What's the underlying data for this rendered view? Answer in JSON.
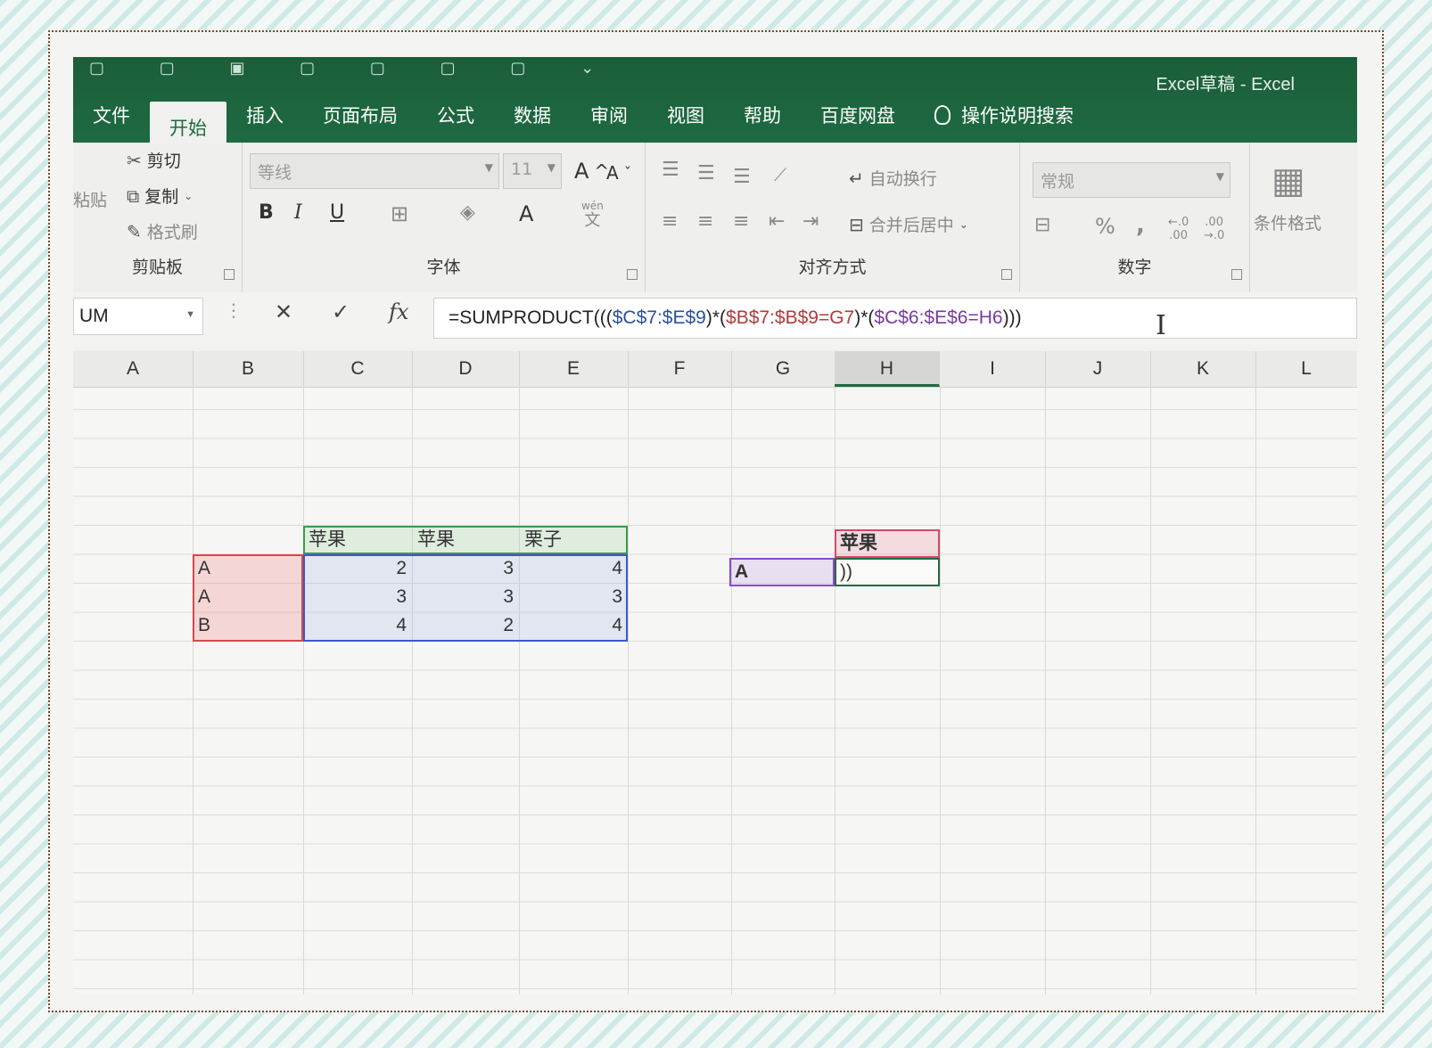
{
  "window": {
    "title": "Excel草稿  -  Excel"
  },
  "tabs": [
    "文件",
    "开始",
    "插入",
    "页面布局",
    "公式",
    "数据",
    "审阅",
    "视图",
    "帮助",
    "百度网盘"
  ],
  "tell_me": "操作说明搜索",
  "clipboard": {
    "paste": "粘贴",
    "cut": "剪切",
    "copy": "复制",
    "format_painter": "格式刷",
    "label": "剪贴板"
  },
  "font": {
    "name": "等线",
    "size": "11",
    "bold": "B",
    "italic": "I",
    "underline": "U",
    "font_color": "A",
    "phonetic_top": "wén",
    "phonetic_bottom": "文",
    "grow": "A",
    "shrink": "A",
    "label": "字体"
  },
  "alignment": {
    "wrap": "自动换行",
    "merge": "合并后居中",
    "label": "对齐方式"
  },
  "number": {
    "format": "常规",
    "percent": "%",
    "comma": ",",
    "inc_top": "←.0",
    "inc_bottom": ".00",
    "dec_top": ".00",
    "dec_bottom": "→.0",
    "label": "数字"
  },
  "styles": {
    "conditional": "条件格式"
  },
  "formula_bar": {
    "name_box": "UM",
    "cancel": "✕",
    "enter": "✓",
    "fx": "fx",
    "formula_prefix": "=SUMPRODUCT(((",
    "part1": "$C$7:$E$9",
    "mid1": ")*(",
    "part2": "$B$7:$B$9=G7",
    "mid2": ")*(",
    "part3": "$C$6:$E$6=H6",
    "suffix": ")))"
  },
  "columns": [
    "A",
    "B",
    "C",
    "D",
    "E",
    "F",
    "G",
    "H",
    "I",
    "J",
    "K",
    "L"
  ],
  "cells": {
    "C6": "苹果",
    "D6": "苹果",
    "E6": "栗子",
    "B7": "A",
    "C7": "2",
    "D7": "3",
    "E7": "4",
    "B8": "A",
    "C8": "3",
    "D8": "3",
    "E8": "3",
    "B9": "B",
    "C9": "4",
    "D9": "2",
    "E9": "4",
    "H6": "苹果",
    "G7": "A",
    "H7": "))"
  },
  "colors": {
    "ribbon_green": "#1e6b42",
    "range_blue": "#3a5ac8",
    "range_red": "#d24a4a",
    "range_purple": "#8a4ac8",
    "range_green": "#3a9a4a"
  }
}
